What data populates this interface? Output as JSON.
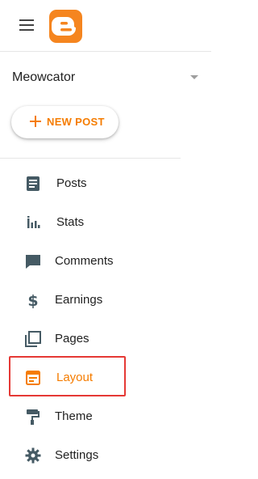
{
  "header": {
    "menu_icon": "hamburger-menu-icon",
    "logo_icon": "blogger-logo-icon",
    "brand_color": "#f5851f"
  },
  "blog": {
    "name": "Meowcator",
    "dropdown_icon": "caret-down-icon"
  },
  "new_post": {
    "label": "NEW POST",
    "icon": "plus-icon",
    "color": "#f57c00"
  },
  "nav": {
    "items": [
      {
        "label": "Posts",
        "icon": "posts-icon"
      },
      {
        "label": "Stats",
        "icon": "stats-icon"
      },
      {
        "label": "Comments",
        "icon": "comments-icon"
      },
      {
        "label": "Earnings",
        "icon": "dollar-icon"
      },
      {
        "label": "Pages",
        "icon": "pages-icon"
      },
      {
        "label": "Layout",
        "icon": "layout-icon",
        "active": true
      },
      {
        "label": "Theme",
        "icon": "paint-roller-icon"
      },
      {
        "label": "Settings",
        "icon": "gear-icon"
      }
    ],
    "active_color": "#f57c00",
    "icon_color": "#455a64",
    "highlight_color": "#e53935"
  }
}
